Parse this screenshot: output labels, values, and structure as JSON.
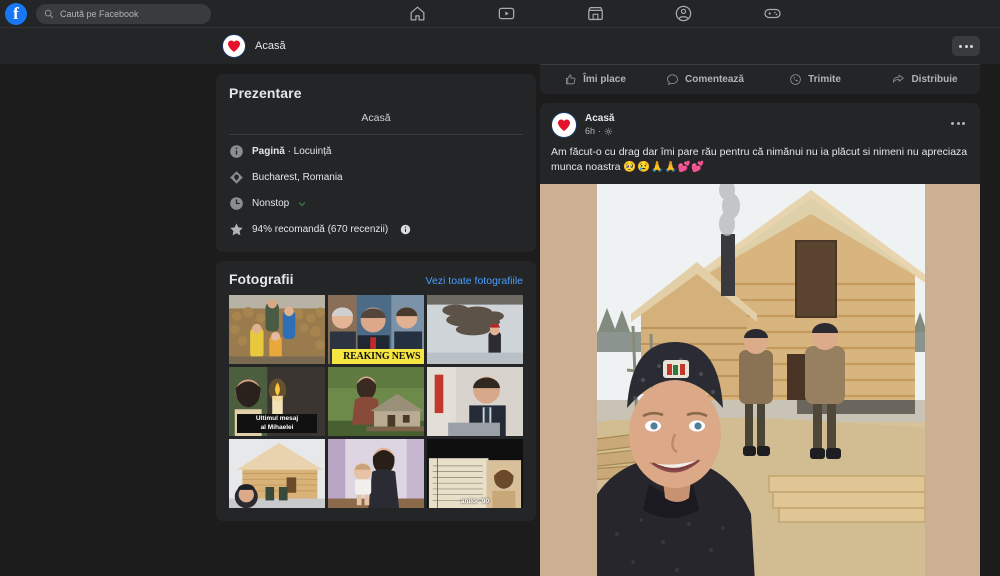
{
  "topbar": {
    "logo_letter": "f",
    "search": {
      "placeholder": "Caută pe Facebook",
      "value": "",
      "icon": "search-icon"
    },
    "nav": [
      {
        "name": "home-icon",
        "label": "Acasă"
      },
      {
        "name": "watch-icon",
        "label": "Video"
      },
      {
        "name": "marketplace-icon",
        "label": "Marketplace"
      },
      {
        "name": "groups-icon",
        "label": "Grupuri"
      },
      {
        "name": "gaming-icon",
        "label": "Jocuri"
      }
    ]
  },
  "page_header": {
    "page_name": "Acasă",
    "avatar": "red-heart-avatar",
    "more_label": "..."
  },
  "intro": {
    "title": "Prezentare",
    "page_name": "Acasă",
    "rows": [
      {
        "icon": "info-icon",
        "text_bold": "Pagină",
        "text": " · Locuință"
      },
      {
        "icon": "location-icon",
        "text": "Bucharest, Romania"
      },
      {
        "icon": "clock-icon",
        "text": "Nonstop",
        "green": true,
        "chevron": true
      },
      {
        "icon": "star-icon",
        "text": "94% recomandă (670 recenzii)",
        "info": true
      }
    ]
  },
  "photos": {
    "title": "Fotografii",
    "see_all": "Vezi toate fotografiile",
    "items": [
      {
        "name": "photo-family-potatoes",
        "caption": ""
      },
      {
        "name": "photo-politicians-news",
        "caption": "REAKING NEWS"
      },
      {
        "name": "photo-sheep-snow",
        "caption": ""
      },
      {
        "name": "photo-candle-woman",
        "caption": "Ultimul mesaj\nal Mihaelei"
      },
      {
        "name": "photo-girl-stone-house",
        "caption": ""
      },
      {
        "name": "photo-politician-podium",
        "caption": ""
      },
      {
        "name": "photo-wooden-cabin-selfie",
        "caption": ""
      },
      {
        "name": "photo-woman-baby",
        "caption": ""
      },
      {
        "name": "photo-notebook-90s",
        "caption": "anilor '90"
      }
    ]
  },
  "action_bar": [
    {
      "icon": "thumbs-up-icon",
      "label": "Îmi place"
    },
    {
      "icon": "comment-icon",
      "label": "Comentează"
    },
    {
      "icon": "send-icon",
      "label": "Trimite"
    },
    {
      "icon": "share-icon",
      "label": "Distribuie"
    }
  ],
  "post": {
    "author": "Acasă",
    "avatar": "red-heart-avatar",
    "timestamp": "6h",
    "separator": "·",
    "audience_icon": "gear-icon",
    "more_label": "...",
    "text": "Am făcut-o cu drag dar îmi pare rău pentru că nimănui nu ia plăcut si nimeni nu apreciaza munca noastra ",
    "emoji": "🥺😢🙏🙏💕💕",
    "media": {
      "name": "log-cabin-construction-selfie",
      "background_color": "#cdb094"
    }
  },
  "colors": {
    "brand": "#1877f2",
    "link": "#4a9eff",
    "green": "#45bd62",
    "card": "#242526",
    "page_bg": "#1c1c1d",
    "heart": "#e4122a"
  }
}
